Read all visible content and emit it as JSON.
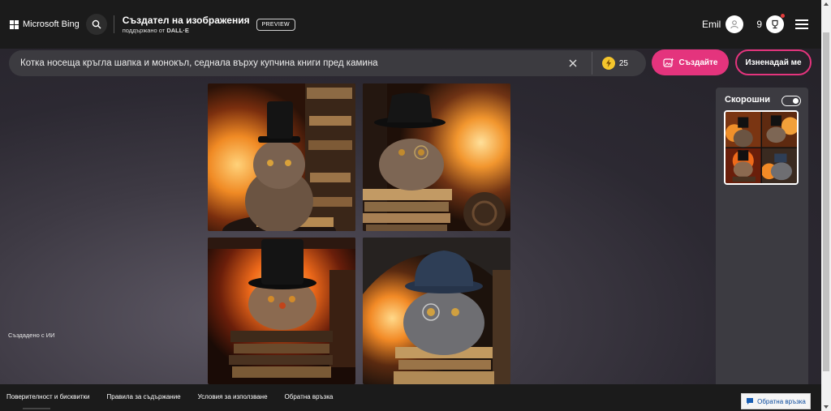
{
  "header": {
    "brand": "Microsoft Bing",
    "title": "Създател на изображения",
    "subtitle_prefix": "поддържано от",
    "subtitle_brand": "DALL·E",
    "badge": "PREVIEW",
    "user_name": "Emil",
    "reward_count": "9"
  },
  "prompt": {
    "text": "Котка носеща кръгла шапка и монокъл, седнала върху купчина книги пред камина",
    "boost_count": "25",
    "create_label": "Създайте",
    "surprise_label": "Изненадай ме"
  },
  "gallery": {
    "ai_label": "Създадено с ИИ"
  },
  "recent": {
    "title": "Скорошни"
  },
  "footer": {
    "links": [
      "Поверителност и бисквитки",
      "Правила за съдържание",
      "Условия за използване",
      "Обратна връзка"
    ],
    "feedback_button": "Обратна връзка"
  },
  "colors": {
    "accent": "#e4347d",
    "header_bg": "#1b1b1b",
    "prompt_bg": "#3c3b40",
    "boost_coin": "#f4c52c"
  }
}
